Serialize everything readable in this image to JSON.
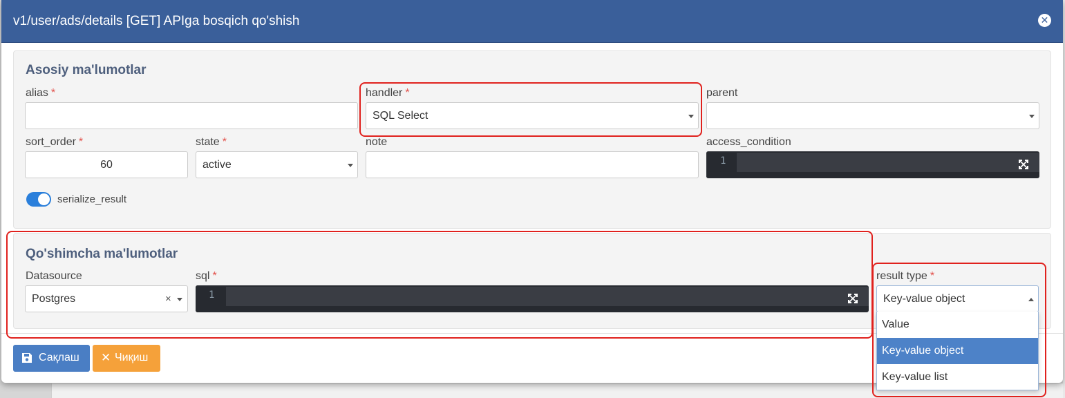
{
  "modal": {
    "title": "v1/user/ads/details [GET] APIga bosqich qo'shish"
  },
  "main_section": {
    "title": "Asosiy ma'lumotlar",
    "alias": {
      "label": "alias",
      "value": ""
    },
    "handler": {
      "label": "handler",
      "value": "SQL Select"
    },
    "parent": {
      "label": "parent",
      "value": ""
    },
    "sort_order": {
      "label": "sort_order",
      "value": "60"
    },
    "state": {
      "label": "state",
      "value": "active"
    },
    "note": {
      "label": "note",
      "value": ""
    },
    "access_condition": {
      "label": "access_condition",
      "line_number": "1"
    },
    "serialize_result": {
      "label": "serialize_result",
      "on": true
    }
  },
  "extra_section": {
    "title": "Qo'shimcha ma'lumotlar",
    "datasource": {
      "label": "Datasource",
      "value": "Postgres",
      "clear": "×"
    },
    "sql": {
      "label": "sql",
      "line_number": "1"
    },
    "result_type": {
      "label": "result type",
      "value": "Key-value object",
      "options": [
        "Value",
        "Key-value object",
        "Key-value list"
      ],
      "selected_index": 1
    }
  },
  "required_mark": "*",
  "buttons": {
    "save": "Сақлаш",
    "exit": "Чиқиш"
  },
  "colors": {
    "header": "#3a5f9a",
    "save": "#4a7ec4",
    "exit": "#f5a13a",
    "highlight": "#e0211d",
    "toggle": "#2a7fdb",
    "selected_option": "#4d82c8"
  }
}
